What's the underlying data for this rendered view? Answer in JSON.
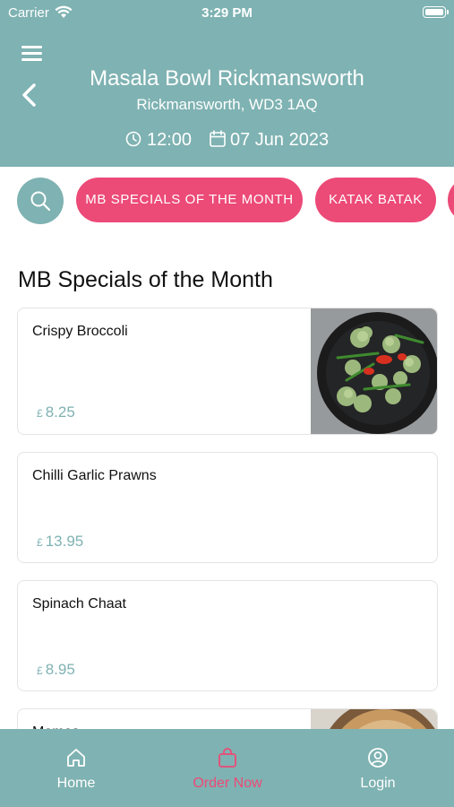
{
  "status_bar": {
    "carrier": "Carrier",
    "time": "3:29 PM"
  },
  "header": {
    "title": "Masala Bowl Rickmansworth",
    "subtitle": "Rickmansworth, WD3 1AQ",
    "time": "12:00",
    "date": "07 Jun 2023"
  },
  "categories": [
    "MB SPECIALS OF THE MONTH",
    "KATAK BATAK"
  ],
  "section_title": "MB Specials of the Month",
  "currency": "£",
  "items": [
    {
      "name": "Crispy Broccoli",
      "price": "8.25"
    },
    {
      "name": "Chilli Garlic Prawns",
      "price": "13.95"
    },
    {
      "name": "Spinach Chaat",
      "price": "8.95"
    },
    {
      "name": "Momos",
      "price": ""
    }
  ],
  "nav": {
    "home": "Home",
    "order": "Order Now",
    "login": "Login"
  },
  "colors": {
    "teal": "#7fb2b2",
    "pink": "#ec4a77"
  }
}
